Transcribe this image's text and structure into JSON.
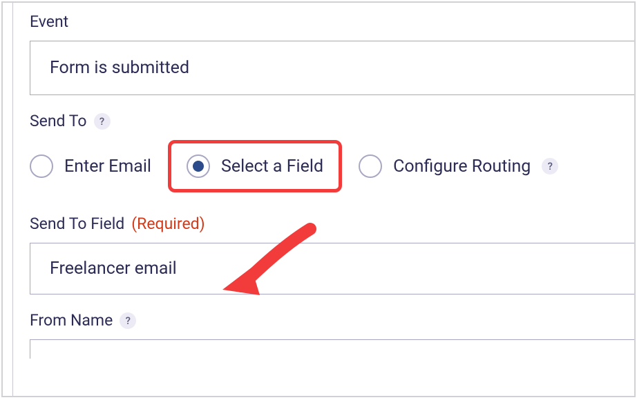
{
  "event": {
    "label": "Event",
    "value": "Form is submitted"
  },
  "sendTo": {
    "label": "Send To",
    "options": {
      "enterEmail": "Enter Email",
      "selectField": "Select a Field",
      "configureRouting": "Configure Routing"
    }
  },
  "sendToField": {
    "label": "Send To Field",
    "required": "(Required)",
    "value": "Freelancer email"
  },
  "fromName": {
    "label": "From Name"
  },
  "helpSymbol": "?"
}
